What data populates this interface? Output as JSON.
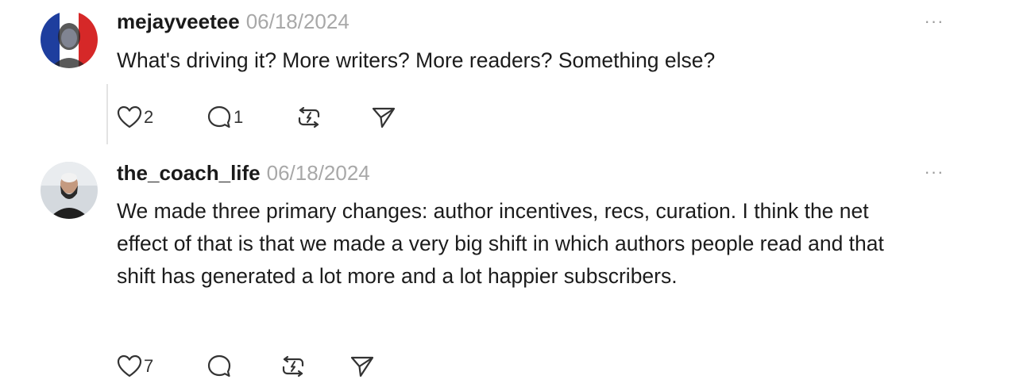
{
  "comments": [
    {
      "username": "mejayveetee",
      "date": "06/18/2024",
      "more_label": "···",
      "text": "What's driving it? More writers? More readers? Something else?",
      "likes": "2",
      "replies": "1",
      "icons": {
        "like": "heart-icon",
        "reply": "comment-icon",
        "restack": "restack-icon",
        "share": "share-icon",
        "more": "more-icon"
      },
      "avatar_colors": [
        "#1e3e9e",
        "#ffffff",
        "#d62828"
      ]
    },
    {
      "username": "the_coach_life",
      "date": "06/18/2024",
      "more_label": "···",
      "text": "We made three primary changes: author incentives, recs, curation. I think the net effect of that is that we made a very big shift in which authors people read and that shift has generated a lot more and a lot happier subscribers.",
      "likes": "7",
      "replies": "",
      "icons": {
        "like": "heart-icon",
        "reply": "comment-icon",
        "restack": "restack-icon",
        "share": "share-icon",
        "more": "more-icon"
      },
      "avatar_colors": [
        "#c9cfd6",
        "#f0f0f0",
        "#2b2b2b"
      ]
    }
  ]
}
